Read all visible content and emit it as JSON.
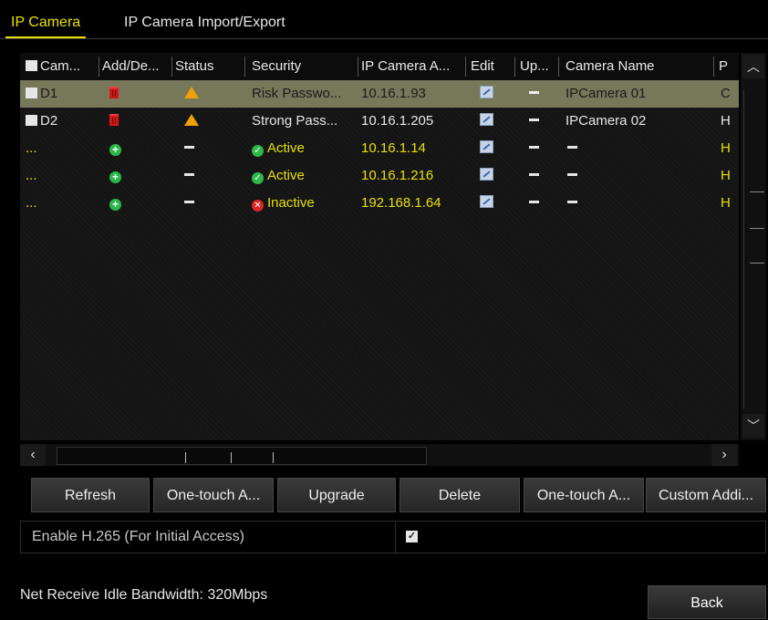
{
  "tabs": [
    {
      "label": "IP Camera",
      "active": true
    },
    {
      "label": "IP Camera Import/Export",
      "active": false
    }
  ],
  "table": {
    "columns": [
      "Cam...",
      "Add/De...",
      "Status",
      "Security",
      "IP Camera A...",
      "Edit",
      "Up...",
      "Camera Name",
      "P"
    ],
    "rows": [
      {
        "camera": "D1",
        "checkbox": true,
        "add_delete": "trash-icon",
        "status": "warning-icon",
        "security": "Risk Passwo...",
        "ip": "10.16.1.93",
        "edit": "edit-icon",
        "upgrade": "-",
        "name": "IPCamera 01",
        "protocol": "C",
        "selected": true
      },
      {
        "camera": "D2",
        "checkbox": true,
        "add_delete": "trash-icon",
        "status": "warning-icon",
        "security": "Strong Pass...",
        "ip": "10.16.1.205",
        "edit": "edit-icon",
        "upgrade": "-",
        "name": "IPCamera 02",
        "protocol": "H"
      },
      {
        "camera": "...",
        "add_delete": "add-icon",
        "status": "-",
        "security": "Active",
        "security_icon": "check-icon",
        "ip": "10.16.1.14",
        "edit": "edit-icon",
        "upgrade": "-",
        "name": "-",
        "protocol": "H"
      },
      {
        "camera": "...",
        "add_delete": "add-icon",
        "status": "-",
        "security": "Active",
        "security_icon": "check-icon",
        "ip": "10.16.1.216",
        "edit": "edit-icon",
        "upgrade": "-",
        "name": "-",
        "protocol": "H"
      },
      {
        "camera": "...",
        "add_delete": "add-icon",
        "status": "-",
        "security": "Inactive",
        "security_icon": "error-icon",
        "ip": "192.168.1.64",
        "edit": "edit-icon",
        "upgrade": "-",
        "name": "-",
        "protocol": "H"
      }
    ]
  },
  "buttons": {
    "refresh": "Refresh",
    "one_touch_activate": "One-touch A...",
    "upgrade": "Upgrade",
    "delete": "Delete",
    "one_touch_adding": "One-touch A...",
    "custom_adding": "Custom Addi..."
  },
  "h265": {
    "label": "Enable H.265 (For Initial Access)",
    "checked": true
  },
  "footer": {
    "bandwidth": "Net Receive Idle Bandwidth: 320Mbps",
    "back": "Back"
  },
  "colors": {
    "accent": "#e8e000",
    "selected_row": "#77785a",
    "active": "#2fb84a",
    "inactive": "#e02424",
    "warning": "#f0a000"
  }
}
